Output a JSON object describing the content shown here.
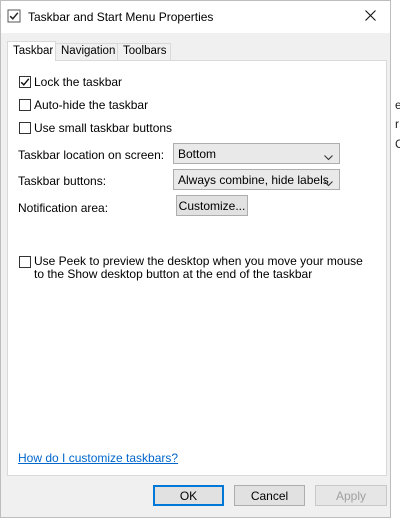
{
  "window": {
    "title": "Taskbar and Start Menu Properties",
    "close_glyph": "✕"
  },
  "tabs": [
    {
      "label": "Taskbar",
      "active": true
    },
    {
      "label": "Navigation",
      "active": false
    },
    {
      "label": "Toolbars",
      "active": false
    }
  ],
  "options": {
    "lock": {
      "label": "Lock the taskbar",
      "checked": true
    },
    "autohide": {
      "label": "Auto-hide the taskbar",
      "checked": false
    },
    "small_buttons": {
      "label": "Use small taskbar buttons",
      "checked": false
    }
  },
  "settings": {
    "location_label": "Taskbar location on screen:",
    "location_value": "Bottom",
    "buttons_label": "Taskbar buttons:",
    "buttons_value": "Always combine, hide labels",
    "notification_label": "Notification area:",
    "customize_label": "Customize..."
  },
  "peek": {
    "label": "Use Peek to preview the desktop when you move your mouse to the Show desktop button at the end of the taskbar",
    "checked": false
  },
  "help_link": "How do I customize taskbars?",
  "footer": {
    "ok": "OK",
    "cancel": "Cancel",
    "apply": "Apply"
  },
  "background_chars": [
    "e",
    "r",
    "C"
  ],
  "colors": {
    "accent": "#0078d7",
    "link": "#0066cc",
    "dialog_bg": "#f0f0f0"
  }
}
